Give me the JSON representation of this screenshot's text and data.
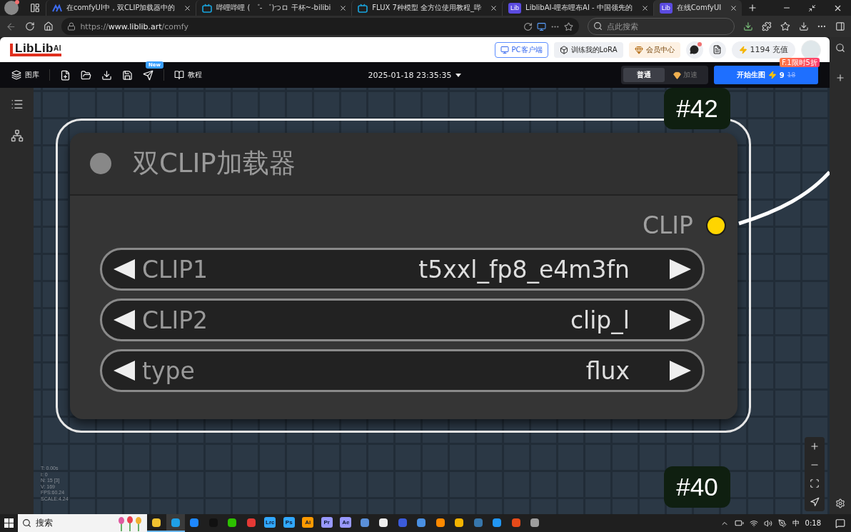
{
  "browser": {
    "tabs": [
      {
        "title": "在comfyUI中，双CLIP加载器中的",
        "kind": "chevrons",
        "selected": false
      },
      {
        "title": "哔哩哔哩 ( ゜- ゜)つロ 干杯~-bilibi",
        "kind": "tv",
        "selected": false
      },
      {
        "title": "FLUX 7种模型 全方位使用教程_哔",
        "kind": "tv",
        "selected": false
      },
      {
        "title": "LiblibAI-哩布哩布AI - 中国领先的",
        "kind": "app",
        "icon_text": "Lib",
        "selected": false
      },
      {
        "title": "在线ComfyUI",
        "kind": "app",
        "icon_text": "Lib",
        "selected": true
      }
    ],
    "url_prefix": "https://",
    "url_host": "www.liblib.art",
    "url_path": "/comfy",
    "search": {
      "placeholder": "点此搜索"
    }
  },
  "header": {
    "logo": "LibLib",
    "logo_suffix": "AI",
    "client_button": "PC客户端",
    "lora_button": "训练我的LoRA",
    "vip_button": "会员中心",
    "messages_unread": true,
    "credits": "1194",
    "recharge": "充值"
  },
  "toolbar": {
    "gallery": "图库",
    "new_badge": "New",
    "tutorial": "教程",
    "datetime": "2025-01-18 23:35:35",
    "modes": [
      {
        "label": "普通",
        "selected": true
      },
      {
        "label": "加速",
        "selected": false
      }
    ],
    "generate": {
      "label": "开始生图",
      "cost": "9",
      "original_cost": "18",
      "promo": "F.1限时5折"
    }
  },
  "node": {
    "badge": "#42",
    "title": "双CLIP加载器",
    "output": "CLIP",
    "widgets": [
      {
        "label": "CLIP1",
        "value": "t5xxl_fp8_e4m3fn"
      },
      {
        "label": "CLIP2",
        "value": "clip_l"
      },
      {
        "label": "type",
        "value": "flux"
      }
    ]
  },
  "other_badge": "#40",
  "stats": [
    "T: 0.00s",
    "I: 0",
    "N: 15 [3]",
    "V: 169",
    "FPS:60.24",
    "SCALE:4.24"
  ],
  "taskbar": {
    "search": "搜索",
    "apps": [
      {
        "kind": "icon",
        "color": "#f2c230",
        "running": true,
        "selected": false
      },
      {
        "kind": "icon",
        "color": "#1fa0e6",
        "running": true,
        "selected": true
      },
      {
        "kind": "icon",
        "color": "#1e88ff",
        "running": false,
        "selected": false
      },
      {
        "kind": "icon",
        "color": "#111111",
        "running": false,
        "selected": false
      },
      {
        "kind": "icon",
        "color": "#2dc100",
        "running": false,
        "selected": false
      },
      {
        "kind": "icon",
        "color": "#e53935",
        "running": false,
        "selected": false
      },
      {
        "kind": "letters",
        "label": "Lrc",
        "color": "#31a8ff",
        "running": false,
        "selected": false
      },
      {
        "kind": "letters",
        "label": "Ps",
        "color": "#31a8ff",
        "running": false,
        "selected": false
      },
      {
        "kind": "letters",
        "label": "Ai",
        "color": "#ff9a00",
        "running": false,
        "selected": false
      },
      {
        "kind": "letters",
        "label": "Pr",
        "color": "#9999ff",
        "running": false,
        "selected": false
      },
      {
        "kind": "letters",
        "label": "Ae",
        "color": "#9999ff",
        "running": false,
        "selected": false
      },
      {
        "kind": "icon",
        "color": "#5a8fd8",
        "running": false,
        "selected": false
      },
      {
        "kind": "icon",
        "color": "#eeeeee",
        "running": false,
        "selected": false
      },
      {
        "kind": "icon",
        "color": "#3b5bdb",
        "running": false,
        "selected": false
      },
      {
        "kind": "icon",
        "color": "#4a90e2",
        "running": false,
        "selected": false
      },
      {
        "kind": "icon",
        "color": "#ff8a00",
        "running": false,
        "selected": false
      },
      {
        "kind": "icon",
        "color": "#f5b400",
        "running": false,
        "selected": false
      },
      {
        "kind": "icon",
        "color": "#3776ab",
        "running": false,
        "selected": false
      },
      {
        "kind": "icon",
        "color": "#2196f3",
        "running": false,
        "selected": false
      },
      {
        "kind": "icon",
        "color": "#e64a19",
        "running": false,
        "selected": false
      },
      {
        "kind": "icon",
        "color": "#9e9e9e",
        "running": false,
        "selected": false
      }
    ],
    "ime": "中",
    "time": "0:18"
  }
}
